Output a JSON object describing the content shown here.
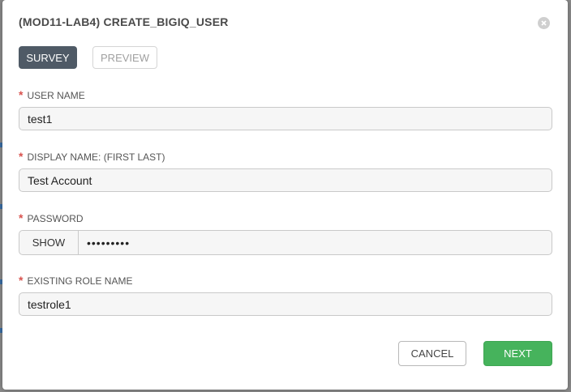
{
  "modal": {
    "title": "(MOD11-LAB4) CREATE_BIGIQ_USER",
    "tabs": [
      {
        "label": "SURVEY",
        "active": true
      },
      {
        "label": "PREVIEW",
        "active": false
      }
    ],
    "required_marker": "*",
    "fields": {
      "user_name": {
        "label": "USER NAME",
        "value": "test1"
      },
      "display_name": {
        "label": "DISPLAY NAME: (FIRST LAST)",
        "value": "Test Account"
      },
      "password": {
        "label": "PASSWORD",
        "show_label": "SHOW",
        "masked_value": "•••••••••"
      },
      "role_name": {
        "label": "EXISTING ROLE NAME",
        "value": "testrole1"
      }
    },
    "buttons": {
      "cancel": "CANCEL",
      "next": "NEXT"
    }
  },
  "colors": {
    "active_tab": "#4f5a66",
    "next_button": "#46b35c",
    "required": "#d9534f"
  }
}
